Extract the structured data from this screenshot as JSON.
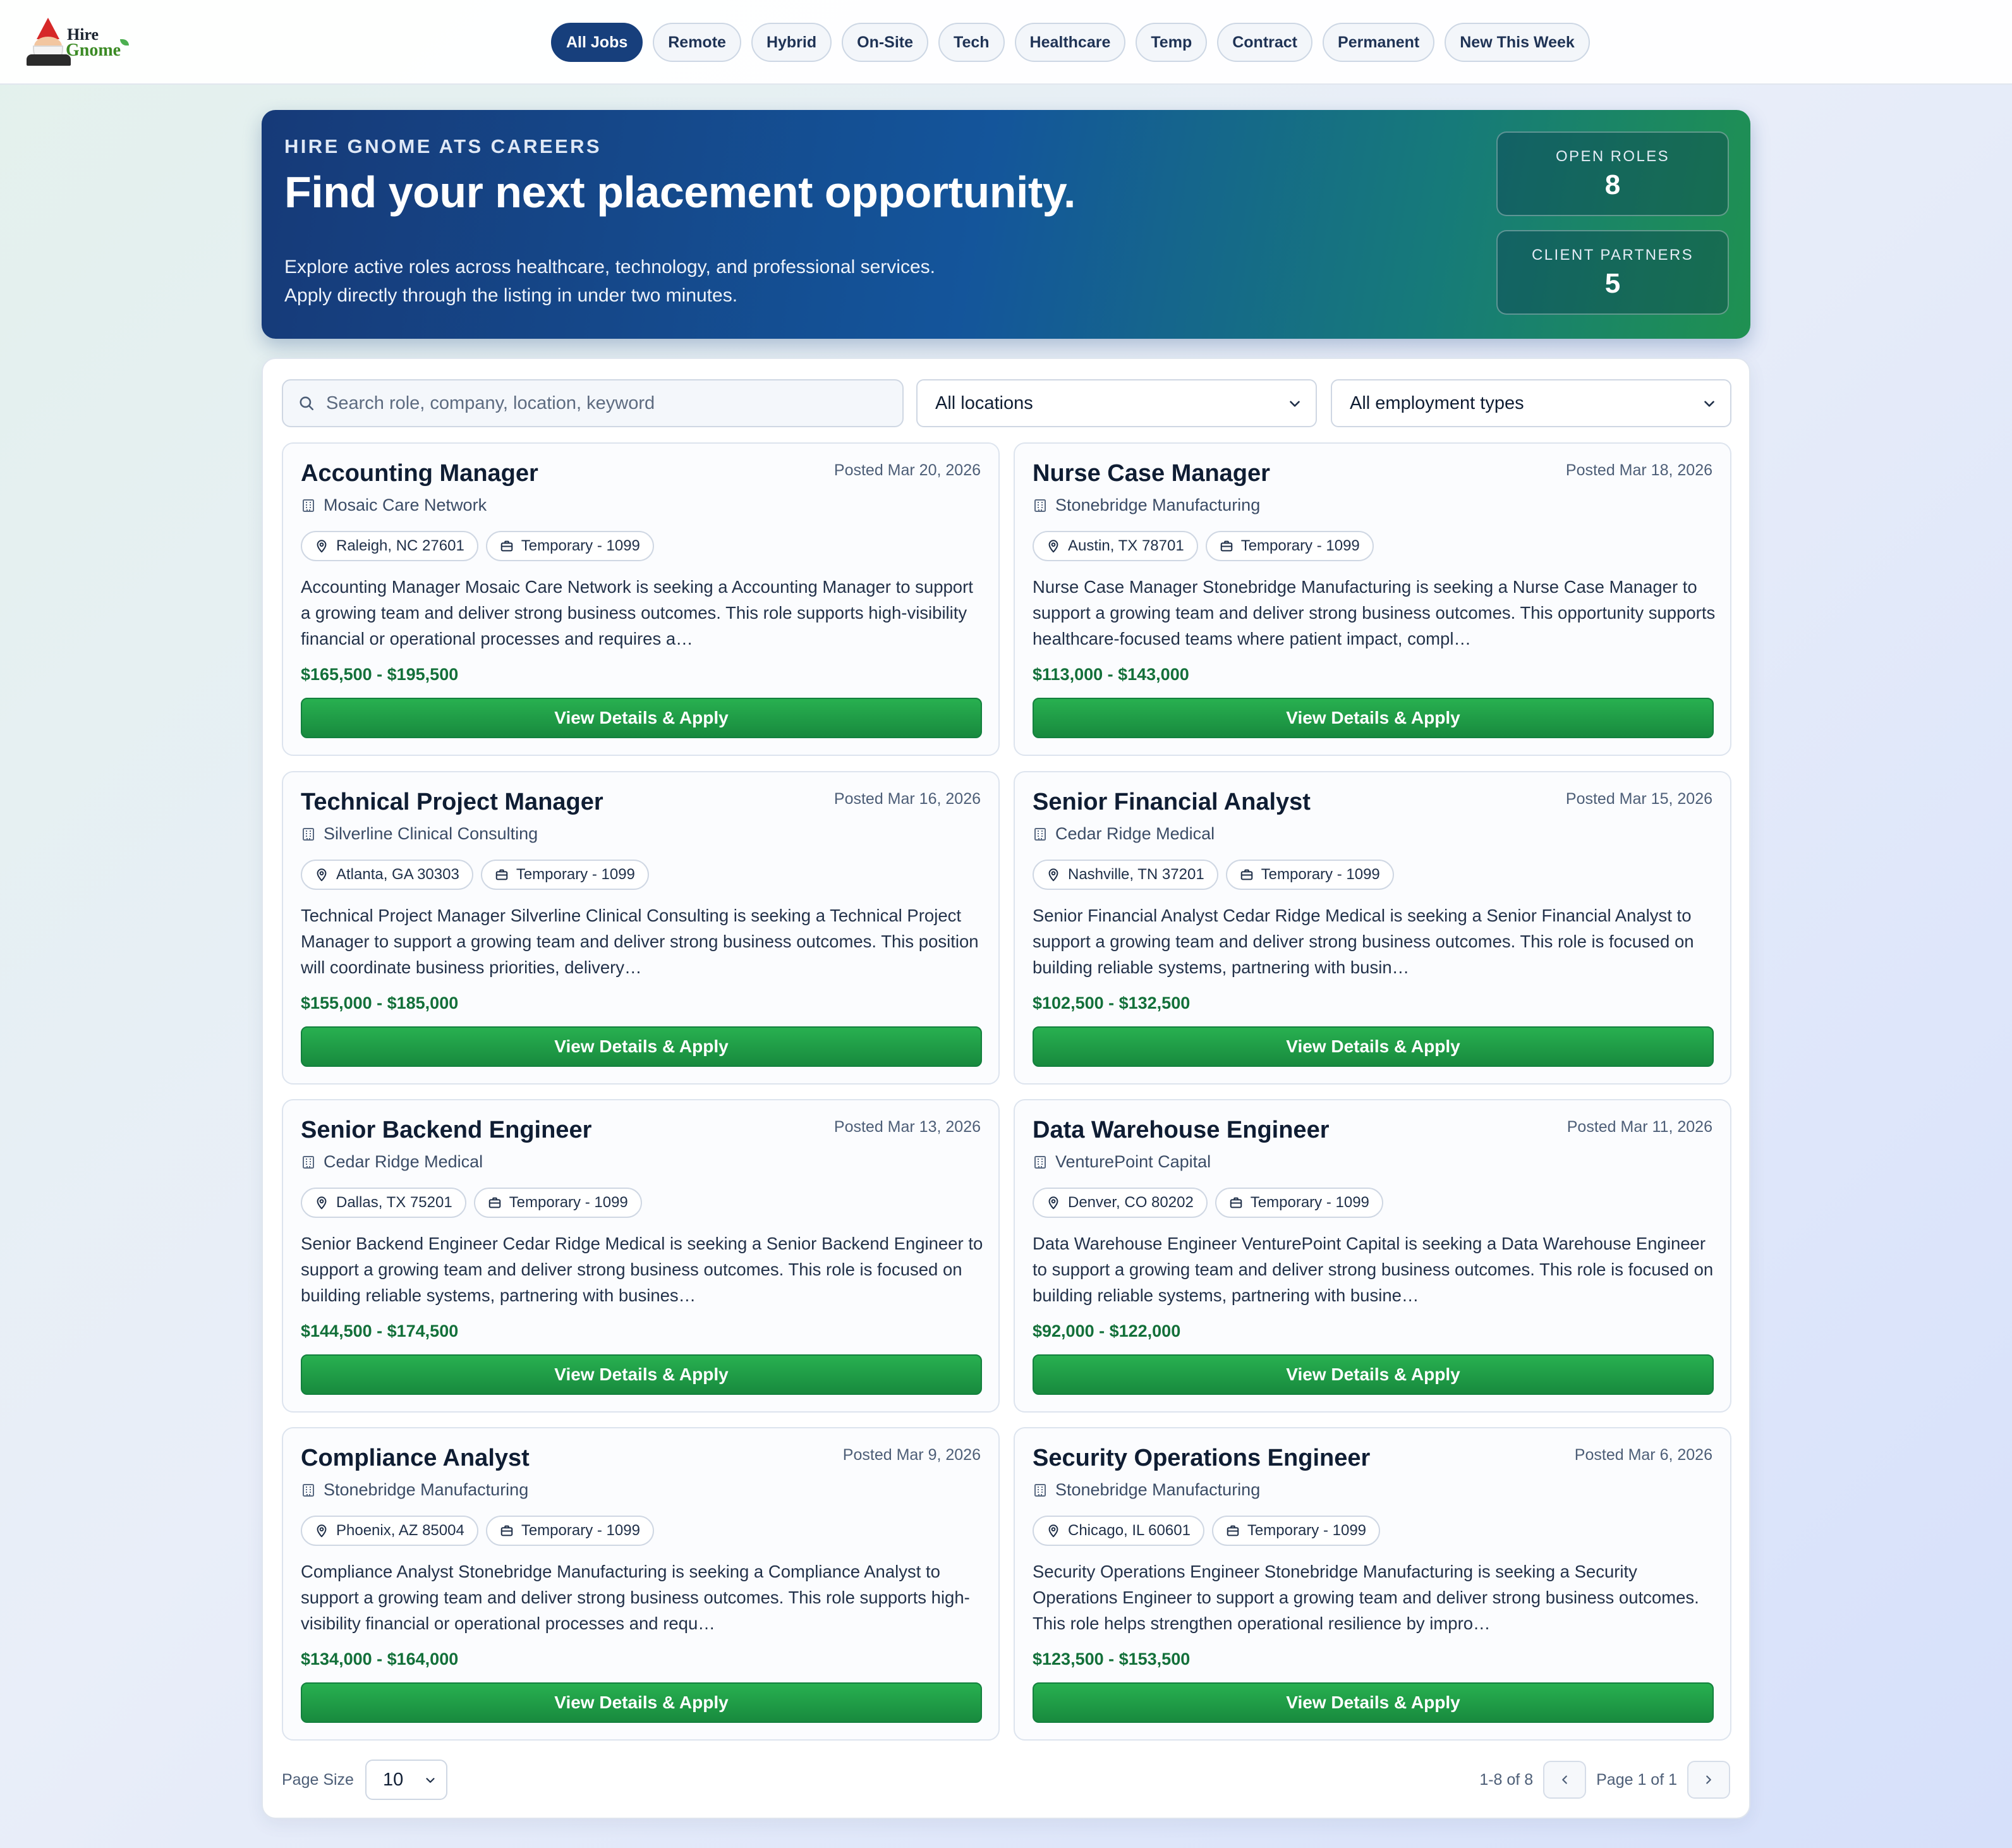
{
  "brand": {
    "logo_line1": "Hire",
    "logo_line2": "Gnome"
  },
  "nav": {
    "pills": [
      "All Jobs",
      "Remote",
      "Hybrid",
      "On-Site",
      "Tech",
      "Healthcare",
      "Temp",
      "Contract",
      "Permanent",
      "New This Week"
    ],
    "active": "All Jobs"
  },
  "hero": {
    "eyebrow": "HIRE GNOME ATS CAREERS",
    "title": "Find your next placement opportunity.",
    "subtitle_line1": "Explore active roles across healthcare, technology, and professional services.",
    "subtitle_line2": "Apply directly through the listing in under two minutes.",
    "stats": [
      {
        "label": "OPEN ROLES",
        "value": "8"
      },
      {
        "label": "CLIENT PARTNERS",
        "value": "5"
      }
    ]
  },
  "filters": {
    "search_placeholder": "Search role, company, location, keyword",
    "search_value": "",
    "location_selected": "All locations",
    "type_selected": "All employment types"
  },
  "jobs": [
    {
      "title": "Accounting Manager",
      "posted": "Posted Mar 20, 2026",
      "company": "Mosaic Care Network",
      "location": "Raleigh, NC 27601",
      "type": "Temporary - 1099",
      "description": "Accounting Manager Mosaic Care Network is seeking a Accounting Manager to support a growing team and deliver strong business outcomes. This role supports high-visibility financial or operational processes and requires a…",
      "salary": "$165,500 - $195,500",
      "cta": "View Details & Apply"
    },
    {
      "title": "Nurse Case Manager",
      "posted": "Posted Mar 18, 2026",
      "company": "Stonebridge Manufacturing",
      "location": "Austin, TX 78701",
      "type": "Temporary - 1099",
      "description": "Nurse Case Manager Stonebridge Manufacturing is seeking a Nurse Case Manager to support a growing team and deliver strong business outcomes. This opportunity supports healthcare-focused teams where patient impact, compl…",
      "salary": "$113,000 - $143,000",
      "cta": "View Details & Apply"
    },
    {
      "title": "Technical Project Manager",
      "posted": "Posted Mar 16, 2026",
      "company": "Silverline Clinical Consulting",
      "location": "Atlanta, GA 30303",
      "type": "Temporary - 1099",
      "description": "Technical Project Manager Silverline Clinical Consulting is seeking a Technical Project Manager to support a growing team and deliver strong business outcomes. This position will coordinate business priorities, delivery…",
      "salary": "$155,000 - $185,000",
      "cta": "View Details & Apply"
    },
    {
      "title": "Senior Financial Analyst",
      "posted": "Posted Mar 15, 2026",
      "company": "Cedar Ridge Medical",
      "location": "Nashville, TN 37201",
      "type": "Temporary - 1099",
      "description": "Senior Financial Analyst Cedar Ridge Medical is seeking a Senior Financial Analyst to support a growing team and deliver strong business outcomes. This role is focused on building reliable systems, partnering with busin…",
      "salary": "$102,500 - $132,500",
      "cta": "View Details & Apply"
    },
    {
      "title": "Senior Backend Engineer",
      "posted": "Posted Mar 13, 2026",
      "company": "Cedar Ridge Medical",
      "location": "Dallas, TX 75201",
      "type": "Temporary - 1099",
      "description": "Senior Backend Engineer Cedar Ridge Medical is seeking a Senior Backend Engineer to support a growing team and deliver strong business outcomes. This role is focused on building reliable systems, partnering with busines…",
      "salary": "$144,500 - $174,500",
      "cta": "View Details & Apply"
    },
    {
      "title": "Data Warehouse Engineer",
      "posted": "Posted Mar 11, 2026",
      "company": "VenturePoint Capital",
      "location": "Denver, CO 80202",
      "type": "Temporary - 1099",
      "description": "Data Warehouse Engineer VenturePoint Capital is seeking a Data Warehouse Engineer to support a growing team and deliver strong business outcomes. This role is focused on building reliable systems, partnering with busine…",
      "salary": "$92,000 - $122,000",
      "cta": "View Details & Apply"
    },
    {
      "title": "Compliance Analyst",
      "posted": "Posted Mar 9, 2026",
      "company": "Stonebridge Manufacturing",
      "location": "Phoenix, AZ 85004",
      "type": "Temporary - 1099",
      "description": "Compliance Analyst Stonebridge Manufacturing is seeking a Compliance Analyst to support a growing team and deliver strong business outcomes. This role supports high-visibility financial or operational processes and requ…",
      "salary": "$134,000 - $164,000",
      "cta": "View Details & Apply"
    },
    {
      "title": "Security Operations Engineer",
      "posted": "Posted Mar 6, 2026",
      "company": "Stonebridge Manufacturing",
      "location": "Chicago, IL 60601",
      "type": "Temporary - 1099",
      "description": "Security Operations Engineer Stonebridge Manufacturing is seeking a Security Operations Engineer to support a growing team and deliver strong business outcomes. This role helps strengthen operational resilience by impro…",
      "salary": "$123,500 - $153,500",
      "cta": "View Details & Apply"
    }
  ],
  "pagination": {
    "page_size_label": "Page Size",
    "page_size": "10",
    "range": "1-8 of 8",
    "page": "Page 1 of 1"
  },
  "colors": {
    "primary": "#173f7c",
    "apply": "#1f9d4a",
    "salary": "#13703a"
  },
  "icons": [
    "search-icon",
    "chevron-down-icon",
    "building-icon",
    "map-pin-icon",
    "briefcase-icon",
    "chevron-left-icon",
    "chevron-right-icon"
  ]
}
